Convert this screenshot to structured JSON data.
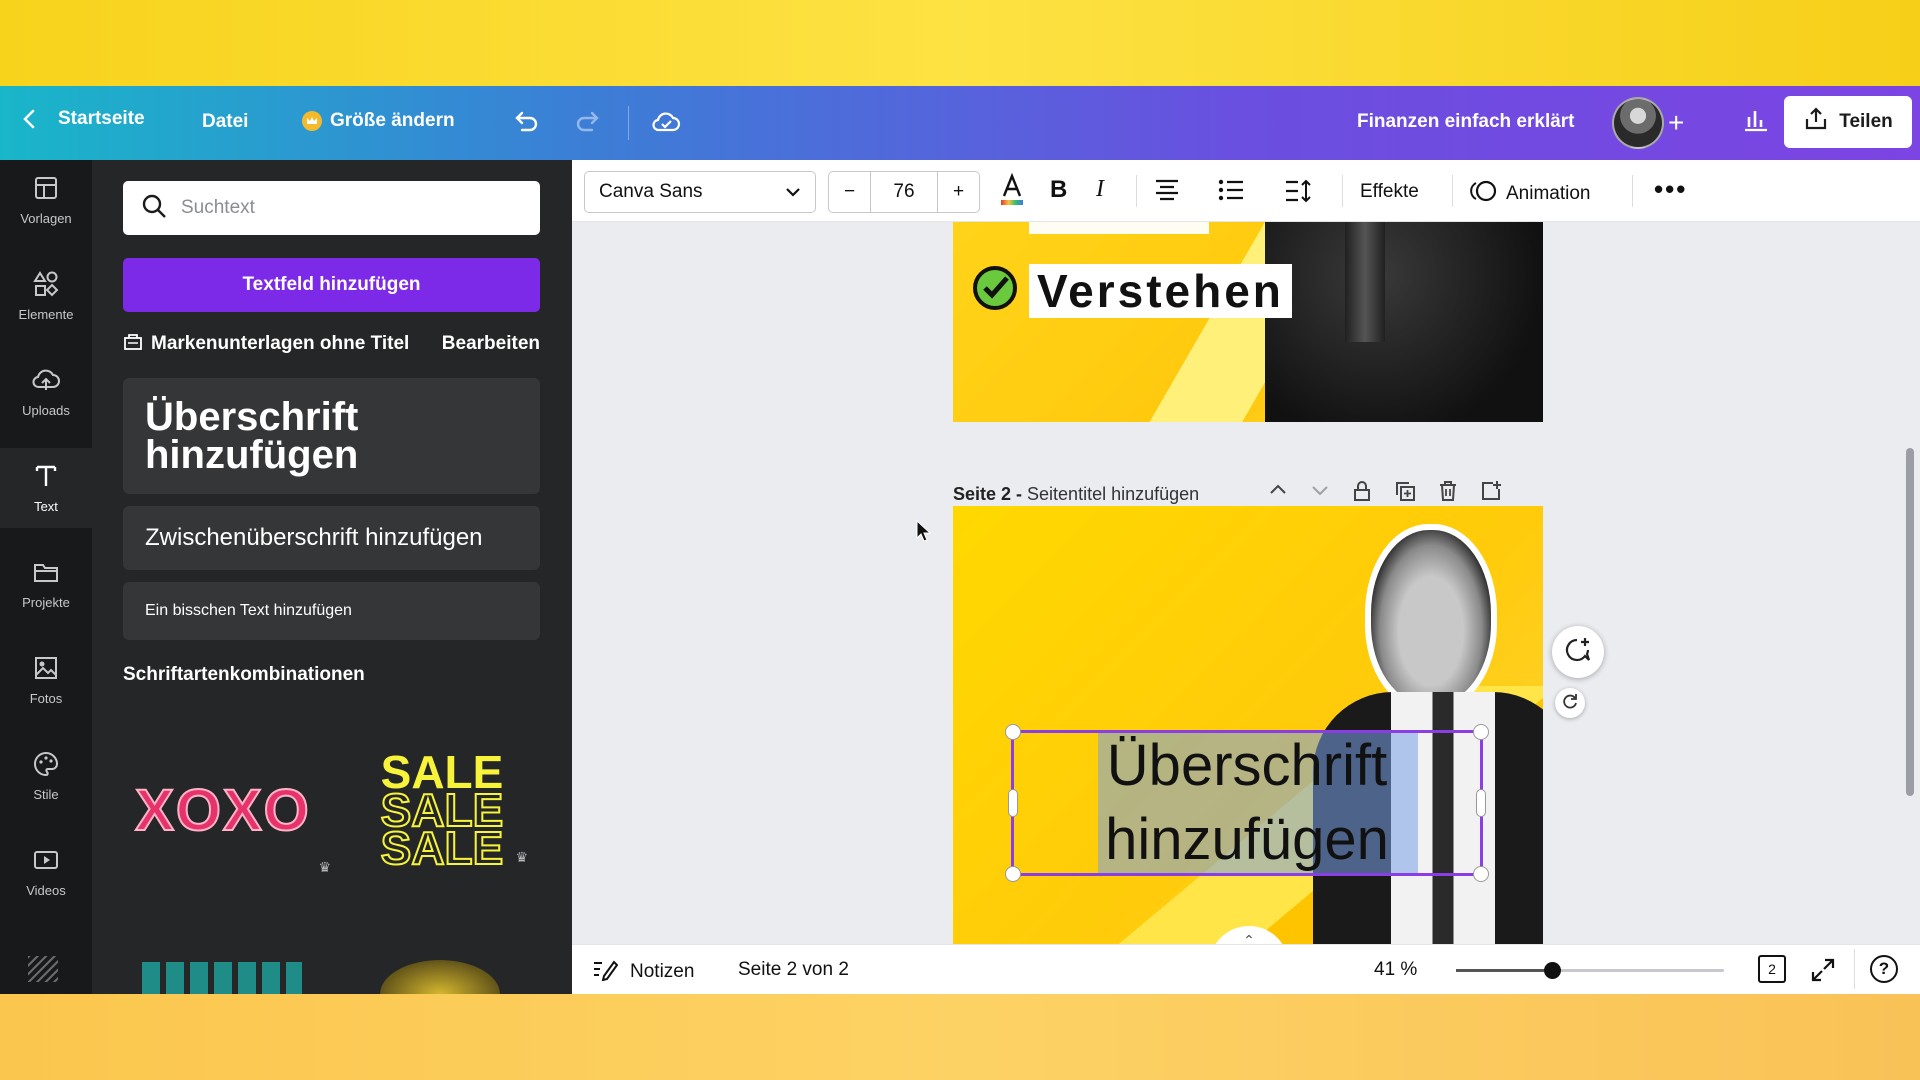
{
  "header": {
    "home_label": "Startseite",
    "file_label": "Datei",
    "resize_label": "Größe ändern",
    "project_title": "Finanzen einfach erklärt",
    "share_label": "Teilen"
  },
  "rail": {
    "items": [
      {
        "label": "Vorlagen",
        "icon": "template-icon"
      },
      {
        "label": "Elemente",
        "icon": "shapes-icon"
      },
      {
        "label": "Uploads",
        "icon": "cloud-upload-icon"
      },
      {
        "label": "Text",
        "icon": "text-icon"
      },
      {
        "label": "Projekte",
        "icon": "folder-icon"
      },
      {
        "label": "Fotos",
        "icon": "image-icon"
      },
      {
        "label": "Stile",
        "icon": "palette-icon"
      },
      {
        "label": "Videos",
        "icon": "video-icon"
      }
    ]
  },
  "panel": {
    "search_placeholder": "Suchtext",
    "add_textbox_label": "Textfeld hinzufügen",
    "brand_label": "Markenunterlagen ohne Titel",
    "brand_edit": "Bearbeiten",
    "heading_label": "Überschrift hinzufügen",
    "subheading_label": "Zwischenüberschrift hinzufügen",
    "body_label": "Ein bisschen Text hinzufügen",
    "combos_heading": "Schriftartenkombinationen",
    "combo1": "XOXO",
    "combo2": "SALE"
  },
  "toolbar": {
    "font_name": "Canva Sans",
    "font_size": "76",
    "minus": "−",
    "plus": "+",
    "bold": "B",
    "italic": "I",
    "effects_label": "Effekte",
    "animation_label": "Animation"
  },
  "canvas": {
    "page1_word": "Verstehen",
    "page2_label_bold": "Seite 2 - ",
    "page2_label_rest": "Seitentitel hinzufügen",
    "selected_text": "Überschrift hinzufügen"
  },
  "bottom": {
    "notes_label": "Notizen",
    "page_indicator": "Seite 2 von 2",
    "zoom": "41 %",
    "page_count": "2"
  }
}
